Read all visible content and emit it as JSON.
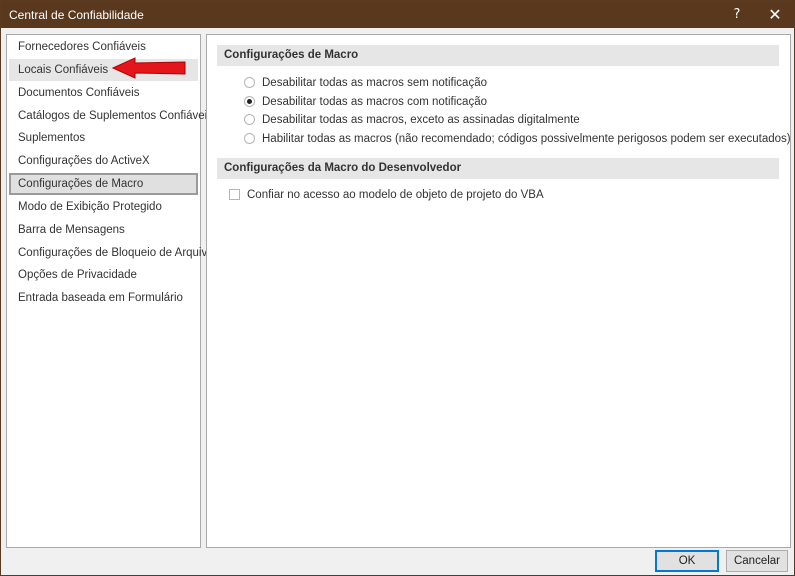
{
  "window": {
    "title": "Central de Confiabilidade",
    "help_glyph": "?",
    "close_glyph": "✕"
  },
  "sidebar": {
    "items": [
      {
        "label": "Fornecedores Confiáveis"
      },
      {
        "label": "Locais Confiáveis"
      },
      {
        "label": "Documentos Confiáveis"
      },
      {
        "label": "Catálogos de Suplementos Confiáveis"
      },
      {
        "label": "Suplementos"
      },
      {
        "label": "Configurações do ActiveX"
      },
      {
        "label": "Configurações de Macro"
      },
      {
        "label": "Modo de Exibição Protegido"
      },
      {
        "label": "Barra de Mensagens"
      },
      {
        "label": "Configurações de Bloqueio de Arquivo"
      },
      {
        "label": "Opções de Privacidade"
      },
      {
        "label": "Entrada baseada em Formulário"
      }
    ],
    "selected_index": 6,
    "hover_index": 1
  },
  "macro_settings": {
    "header": "Configurações de Macro",
    "options": [
      {
        "label": "Desabilitar todas as macros sem notificação",
        "checked": false
      },
      {
        "label": "Desabilitar todas as macros com notificação",
        "checked": true
      },
      {
        "label": "Desabilitar todas as macros, exceto as assinadas digitalmente",
        "checked": false
      },
      {
        "label": "Habilitar todas as macros (não recomendado; códigos possivelmente perigosos podem ser executados)",
        "checked": false
      }
    ]
  },
  "developer_settings": {
    "header": "Configurações da Macro do Desenvolvedor",
    "vba_access_label": "Confiar no acesso ao modelo de objeto de projeto do VBA",
    "vba_access_checked": false
  },
  "buttons": {
    "ok": "OK",
    "cancel": "Cancelar"
  },
  "colors": {
    "titlebar": "#59381d",
    "annotation_arrow": "#e3161b"
  },
  "annotation": {
    "icon": "red-arrow-icon",
    "points_to": "Locais Confiáveis"
  }
}
